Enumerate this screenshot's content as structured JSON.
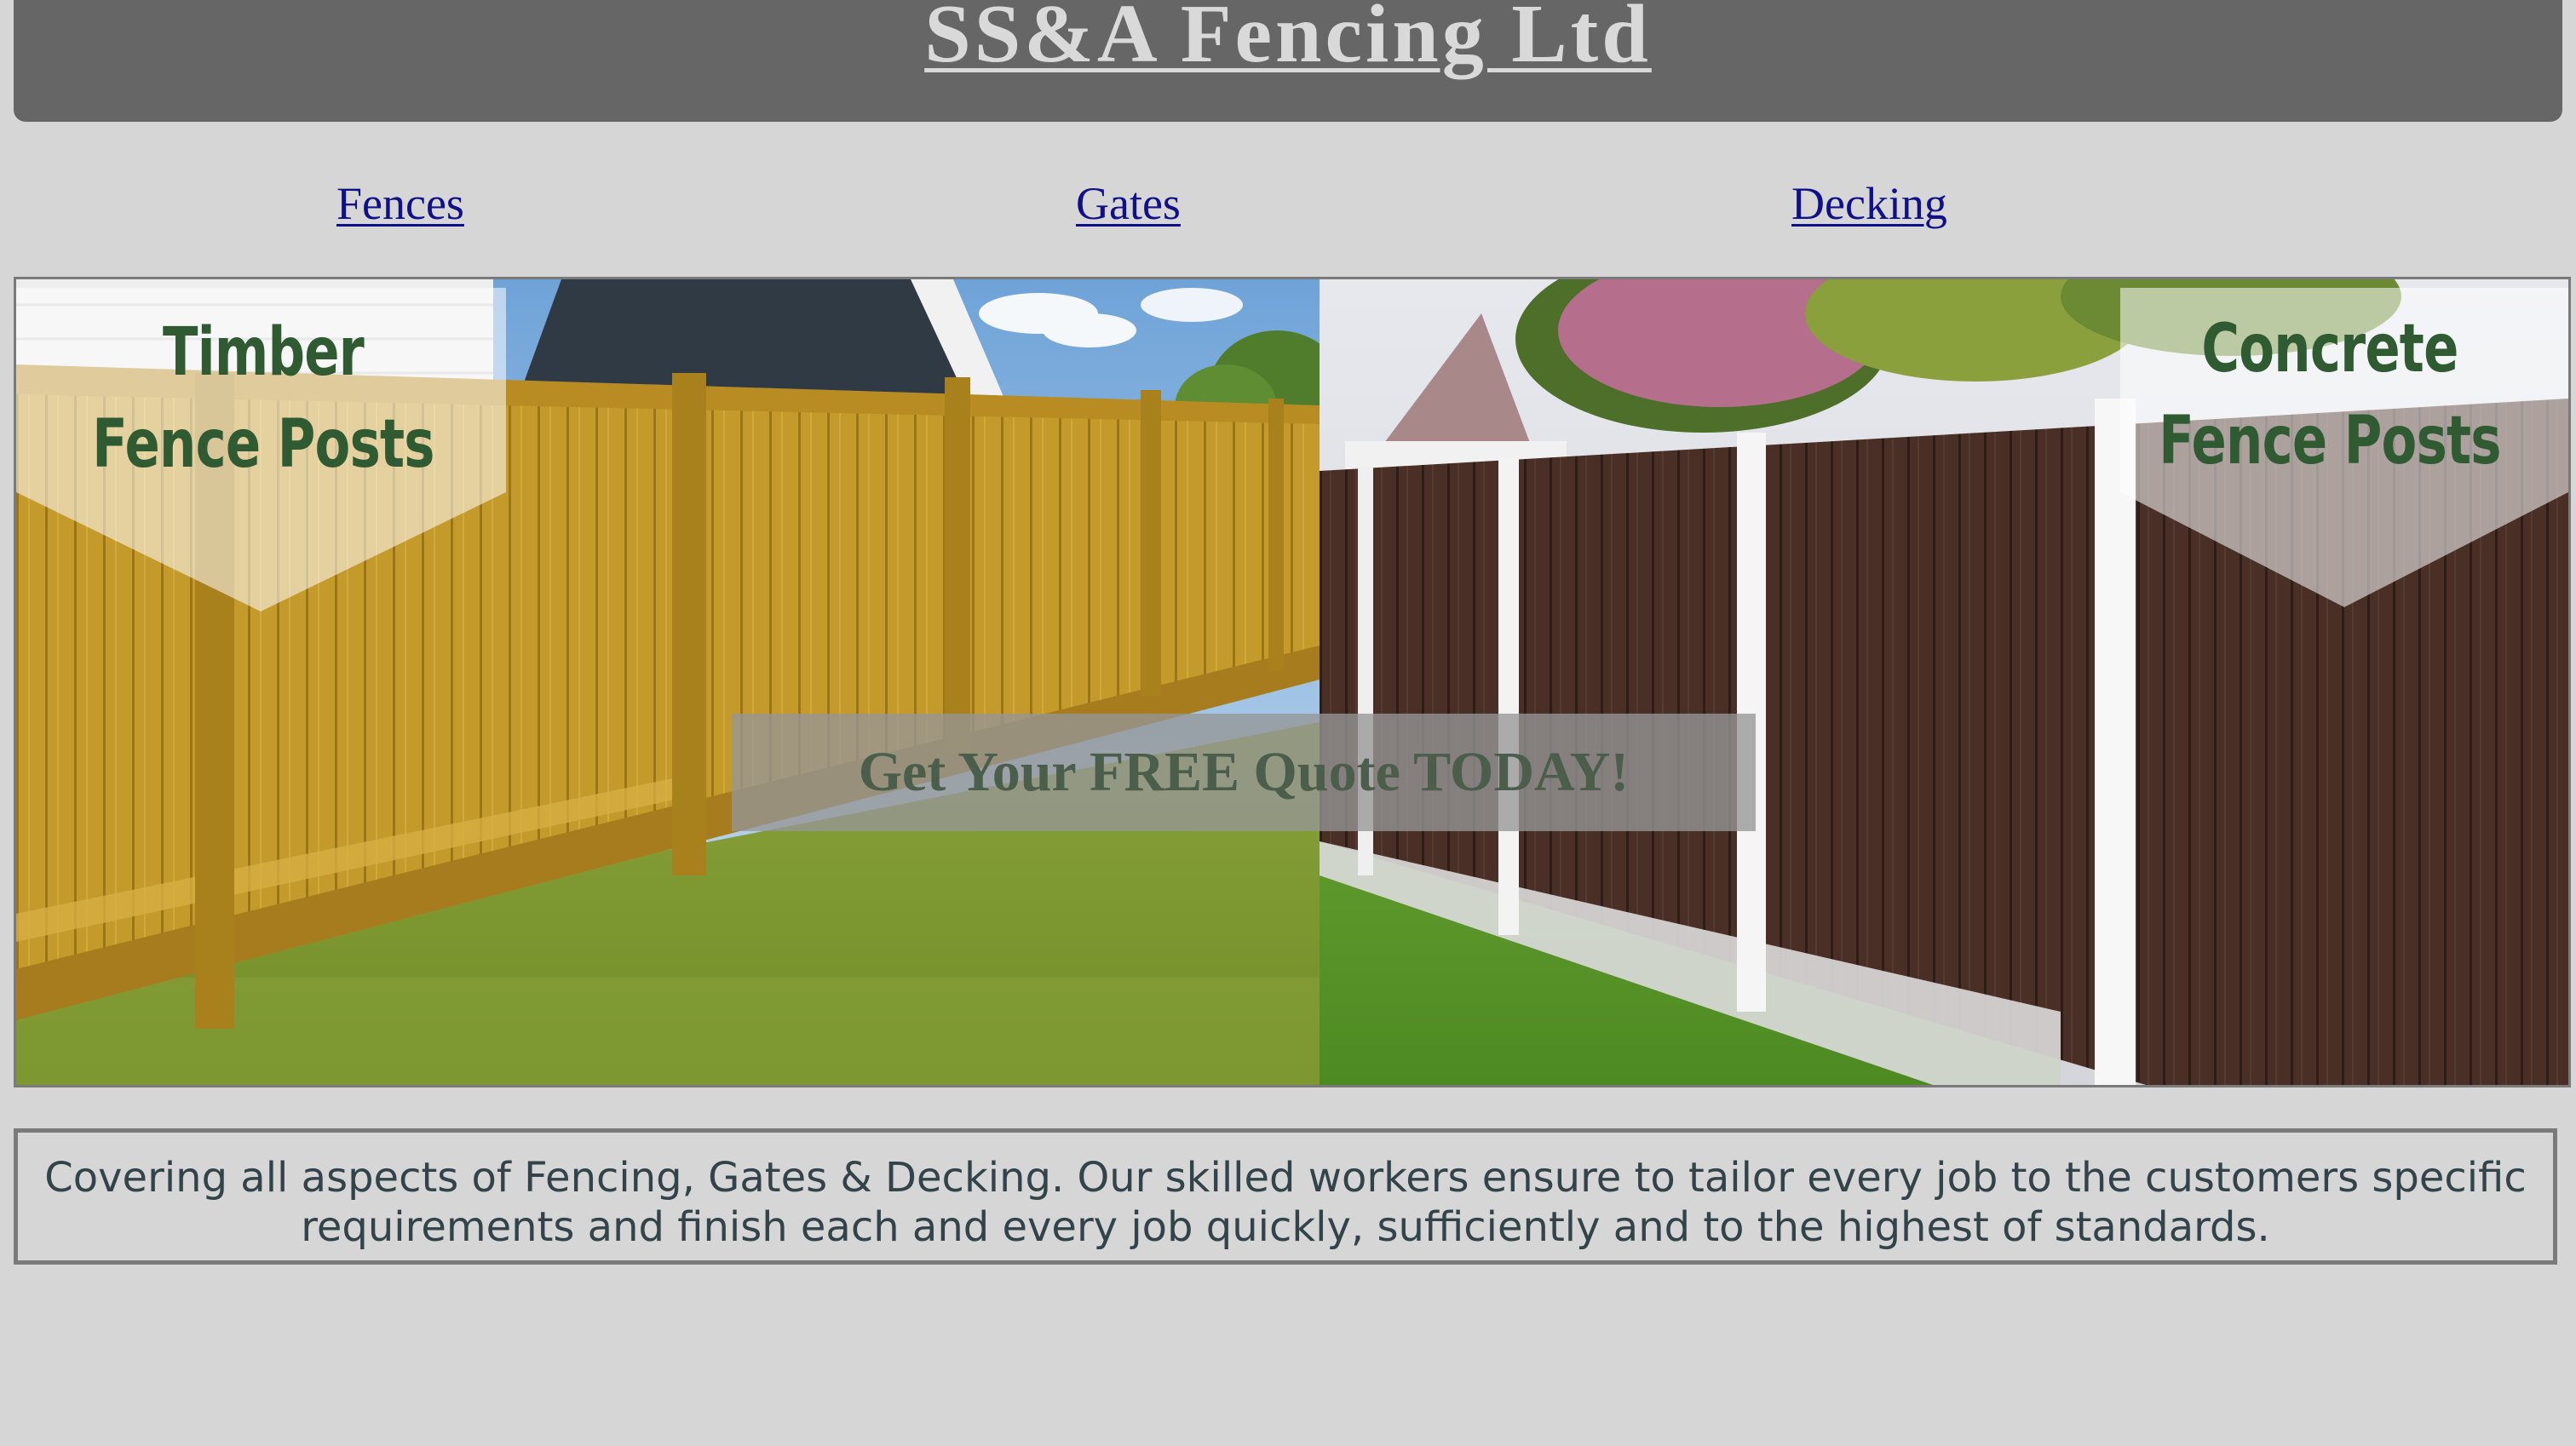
{
  "header": {
    "title": "SS&A Fencing Ltd"
  },
  "nav": {
    "items": [
      {
        "label": "Fences"
      },
      {
        "label": "Gates"
      },
      {
        "label": "Decking"
      }
    ]
  },
  "hero": {
    "timber_label_line1": "Timber",
    "timber_label_line2": "Fence Posts",
    "concrete_label_line1": "Concrete",
    "concrete_label_line2": "Fence Posts",
    "quote_button": "Get Your FREE Quote TODAY!"
  },
  "description": {
    "line1": "Covering all aspects of Fencing, Gates & Decking. Our skilled workers ensure to tailor every job to the customers specific",
    "line2": "requirements and finish each and every job quickly, sufficiently and to the highest of standards."
  },
  "colors": {
    "background": "#d6d6d6",
    "header_bg": "#666666",
    "nav_link": "#10108a",
    "label_green": "#2f5a32",
    "description_text": "#32444a"
  }
}
